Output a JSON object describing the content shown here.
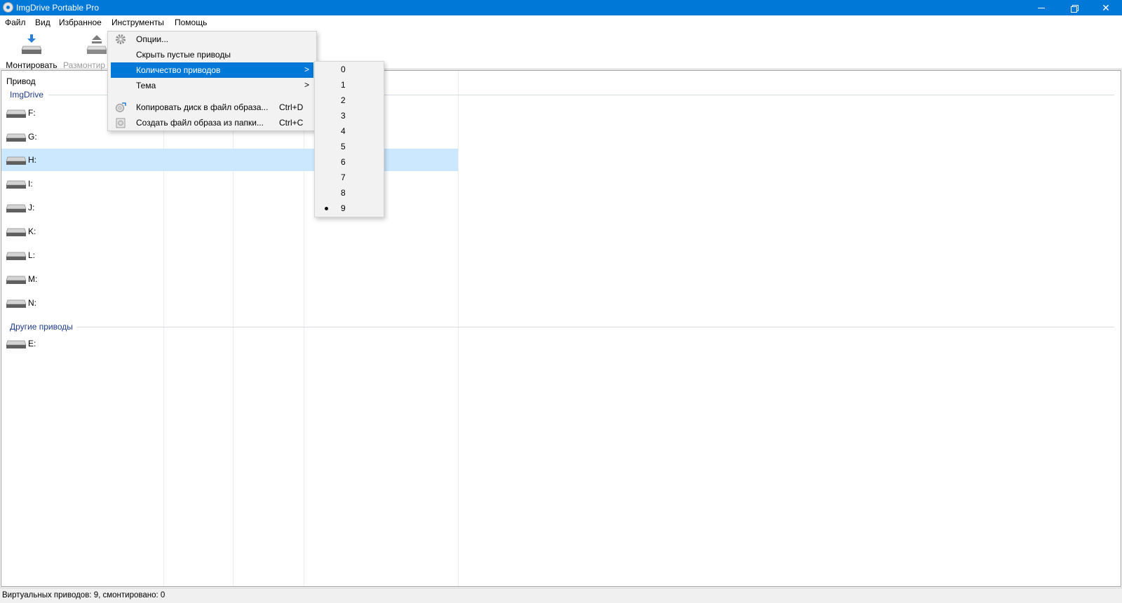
{
  "window": {
    "title": "ImgDrive Portable Pro"
  },
  "menubar": {
    "items": [
      {
        "label": "Файл"
      },
      {
        "label": "Вид"
      },
      {
        "label": "Избранное"
      },
      {
        "label": "Инструменты"
      },
      {
        "label": "Помощь"
      }
    ]
  },
  "toolbar": {
    "mount_label": "Монтировать",
    "unmount_label": "Размонтир"
  },
  "table": {
    "header": "Привод",
    "groups": [
      {
        "title": "ImgDrive",
        "drives": [
          "F:",
          "G:",
          "H:",
          "I:",
          "J:",
          "K:",
          "L:",
          "M:",
          "N:"
        ],
        "selected": "H:"
      },
      {
        "title": "Другие приводы",
        "drives": [
          "E:"
        ]
      }
    ]
  },
  "tools_menu": {
    "items": [
      {
        "label": "Опции...",
        "icon": "gear-icon"
      },
      {
        "label": "Скрыть пустые приводы"
      },
      {
        "label": "Количество приводов",
        "submenu": true,
        "highlighted": true
      },
      {
        "label": "Тема",
        "submenu": true
      },
      {
        "label": "Копировать диск в файл образа...",
        "shortcut": "Ctrl+D",
        "icon": "copy-disc-icon"
      },
      {
        "label": "Создать файл образа из папки...",
        "shortcut": "Ctrl+C",
        "icon": "create-image-icon"
      }
    ],
    "submenu_arrow": ">"
  },
  "drive_count_submenu": {
    "options": [
      "0",
      "1",
      "2",
      "3",
      "4",
      "5",
      "6",
      "7",
      "8",
      "9"
    ],
    "selected": "9"
  },
  "statusbar": {
    "text": "Виртуальных приводов: 9, смонтировано: 0"
  },
  "colors": {
    "titlebar": "#0078d7",
    "highlight": "#0078d7",
    "selection": "#cce8ff",
    "group_text": "#1e3a8a"
  }
}
